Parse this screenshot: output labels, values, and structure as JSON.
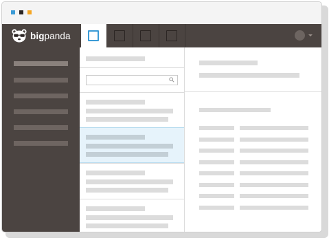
{
  "app": {
    "brand_bold": "big",
    "brand_regular": "panda",
    "icons": [
      "panda-logo-icon",
      "search-icon",
      "user-avatar-icon",
      "chevron-down-icon"
    ]
  },
  "window_controls": {
    "dot_colors": [
      "#3b9bd6",
      "#2b2523",
      "#f5a623"
    ]
  },
  "tabs": [
    {
      "name": "tab-1",
      "active": true
    },
    {
      "name": "tab-2",
      "active": false
    },
    {
      "name": "tab-3",
      "active": false
    },
    {
      "name": "tab-4",
      "active": false
    }
  ],
  "sidebar": {
    "items": [
      {
        "selected": true
      },
      {
        "selected": false
      },
      {
        "selected": false
      },
      {
        "selected": false
      },
      {
        "selected": false
      },
      {
        "selected": false
      }
    ]
  },
  "list": {
    "search": {
      "value": "",
      "placeholder": ""
    },
    "cards": [
      {
        "selected": false
      },
      {
        "selected": true
      },
      {
        "selected": false
      },
      {
        "selected": false
      }
    ]
  },
  "colors": {
    "accent": "#3b9bd6",
    "topbar": "#4b4441",
    "selection": "#e6f3fb",
    "skeleton": "#dcdcdc"
  }
}
